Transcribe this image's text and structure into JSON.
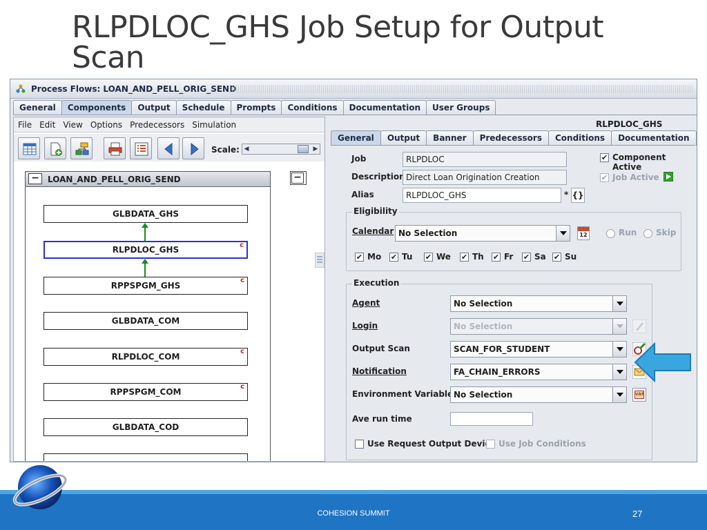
{
  "slide": {
    "title": "RLPDLOC_GHS Job Setup for Output Scan",
    "footer_text": "COHESION SUMMIT",
    "page_number": "27",
    "accent_color": "#1f74c4"
  },
  "window": {
    "title": "Process Flows: LOAN_AND_PELL_ORIG_SEND",
    "tabs": [
      "General",
      "Components",
      "Output",
      "Schedule",
      "Prompts",
      "Conditions",
      "Documentation",
      "User Groups"
    ],
    "active_tab": "Components"
  },
  "left_pane": {
    "menu": [
      "File",
      "Edit",
      "View",
      "Options",
      "Predecessors",
      "Simulation"
    ],
    "scale_label": "Scale:",
    "flow_title": "LOAN_AND_PELL_ORIG_SEND",
    "nodes": [
      {
        "label": "GLBDATA_GHS",
        "selected": false,
        "c": ""
      },
      {
        "label": "RLPDLOC_GHS",
        "selected": true,
        "c": "c"
      },
      {
        "label": "RPPSPGM_GHS",
        "selected": false,
        "c": "c"
      },
      {
        "label": "GLBDATA_COM",
        "selected": false,
        "c": ""
      },
      {
        "label": "RLPDLOC_COM",
        "selected": false,
        "c": "c"
      },
      {
        "label": "RPPSPGM_COM",
        "selected": false,
        "c": "c"
      },
      {
        "label": "GLBDATA_COD",
        "selected": false,
        "c": ""
      }
    ]
  },
  "right_pane": {
    "component_name": "RLPDLOC_GHS",
    "tabs": [
      "General",
      "Output",
      "Banner",
      "Predecessors",
      "Conditions",
      "Documentation"
    ],
    "active_tab": "General",
    "job_label": "Job",
    "job_value": "RLPDLOC",
    "description_label": "Description",
    "description_value": "Direct Loan Origination Creation",
    "alias_label": "Alias",
    "alias_value": "RLPDLOC_GHS",
    "alias_marker": "*",
    "component_active_label": "Component Active",
    "job_active_label": "Job Active",
    "eligibility_label": "Eligibility",
    "calendar_label": "Calendar",
    "calendar_value": "No Selection",
    "run_label": "Run",
    "skip_label": "Skip",
    "days": [
      "Mo",
      "Tu",
      "We",
      "Th",
      "Fr",
      "Sa",
      "Su"
    ],
    "execution_label": "Execution",
    "agent_label": "Agent",
    "agent_value": "No Selection",
    "login_label": "Login",
    "login_value": "No Selection",
    "output_scan_label": "Output Scan",
    "output_scan_value": "SCAN_FOR_STUDENT",
    "notification_label": "Notification",
    "notification_value": "FA_CHAIN_ERRORS",
    "env_label": "Environment Variables",
    "env_value": "No Selection",
    "ave_run_label": "Ave run time",
    "ave_run_value": "",
    "use_request_label": "Use Request Output Device",
    "use_job_cond_label": "Use Job Conditions",
    "calendar_icon_text": "12",
    "var_icon_text": "VAR",
    "braces_text": "{}"
  }
}
